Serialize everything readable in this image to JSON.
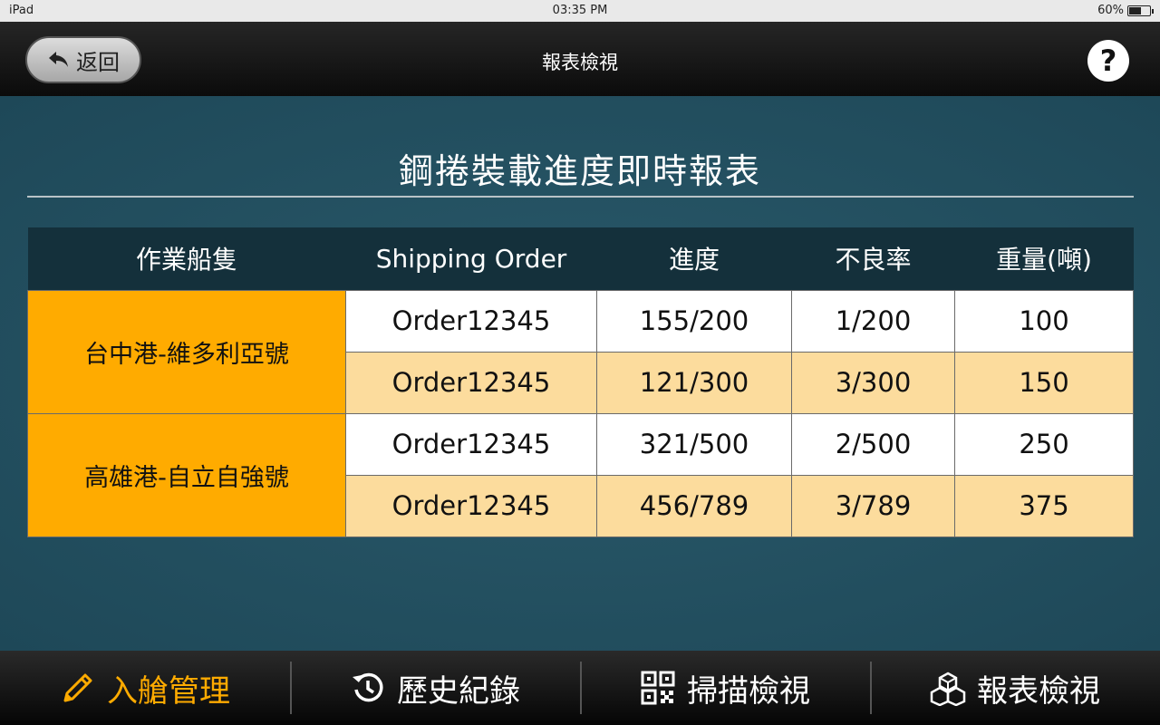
{
  "status_bar": {
    "device": "iPad",
    "time": "03:35 PM",
    "battery": "60%",
    "battery_level": 0.6
  },
  "nav": {
    "back_label": "返回",
    "title": "報表檢視",
    "help_label": "?"
  },
  "report": {
    "title": "鋼捲裝載進度即時報表",
    "headers": [
      "作業船隻",
      "Shipping Order",
      "進度",
      "不良率",
      "重量(噸)"
    ],
    "vessels": [
      {
        "name": "台中港-維多利亞號",
        "rows": [
          {
            "order": "Order12345",
            "progress": "155/200",
            "defect": "1/200",
            "weight": "100"
          },
          {
            "order": "Order12345",
            "progress": "121/300",
            "defect": "3/300",
            "weight": "150"
          }
        ]
      },
      {
        "name": "高雄港-自立自強號",
        "rows": [
          {
            "order": "Order12345",
            "progress": "321/500",
            "defect": "2/500",
            "weight": "250"
          },
          {
            "order": "Order12345",
            "progress": "456/789",
            "defect": "3/789",
            "weight": "375"
          }
        ]
      }
    ]
  },
  "tabs": [
    {
      "label": "入艙管理",
      "icon": "pencil-icon",
      "active": true
    },
    {
      "label": "歷史紀錄",
      "icon": "history-icon",
      "active": false
    },
    {
      "label": "掃描檢視",
      "icon": "qr-code-icon",
      "active": false
    },
    {
      "label": "報表檢視",
      "icon": "boxes-icon",
      "active": false
    }
  ],
  "colors": {
    "accent": "#ffab00",
    "row_alt": "#fcdc9d",
    "header_bg": "#14303b",
    "background": "#1f4b5c"
  }
}
